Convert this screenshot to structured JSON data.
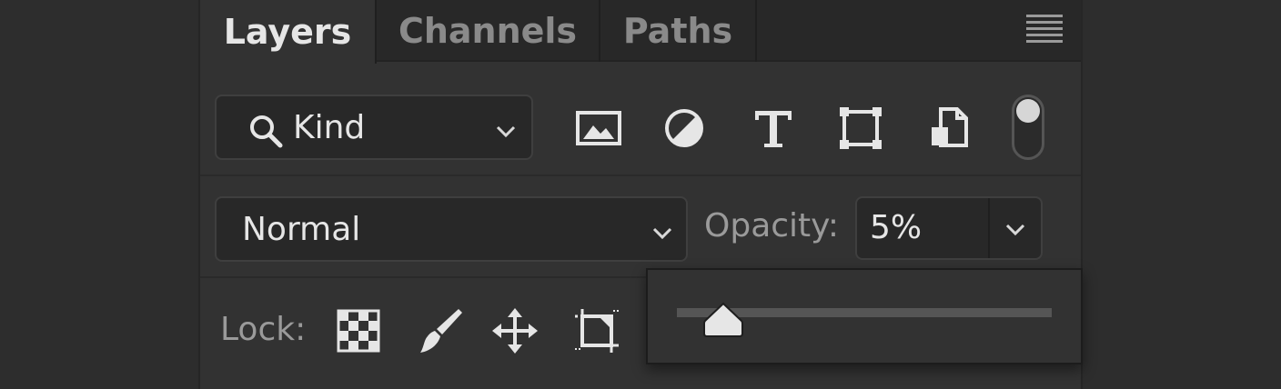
{
  "tabs": [
    {
      "label": "Layers",
      "active": true
    },
    {
      "label": "Channels",
      "active": false
    },
    {
      "label": "Paths",
      "active": false
    }
  ],
  "panel_menu_icon": "hamburger-menu-icon",
  "filter": {
    "kind_label": "Kind",
    "icons": [
      "image-filter-icon",
      "adjustment-filter-icon",
      "type-filter-icon",
      "shape-filter-icon",
      "smart-object-filter-icon"
    ],
    "toggle_on": true
  },
  "blend": {
    "mode": "Normal",
    "opacity_label": "Opacity:",
    "opacity_value": "5%"
  },
  "lock": {
    "label": "Lock:",
    "icons": [
      "lock-transparent-pixels-icon",
      "lock-image-pixels-icon",
      "lock-position-icon",
      "lock-artboard-icon"
    ]
  },
  "opacity_slider": {
    "value_percent": 5
  },
  "colors": {
    "panel_bg": "#323232",
    "tabbar_bg": "#282828",
    "text_active": "#e6e6e6",
    "text_dim": "#8a8a8a"
  }
}
